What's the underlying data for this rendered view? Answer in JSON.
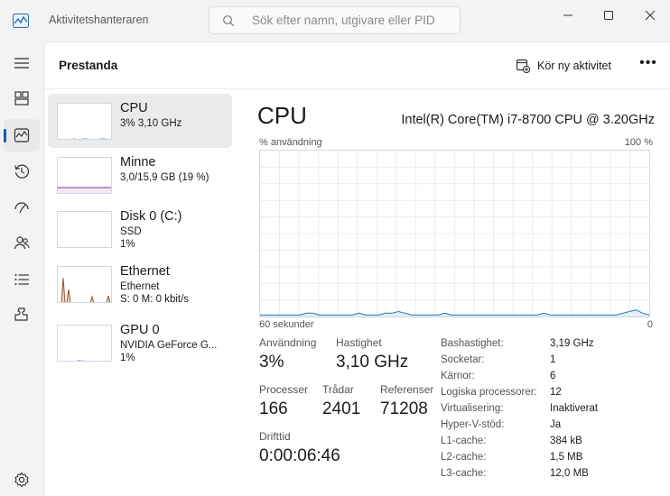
{
  "window": {
    "title": "Aktivitetshanteraren",
    "search_placeholder": "Sök efter namn, utgivare eller PID"
  },
  "nav": {
    "items": [
      {
        "icon": "hamburger-menu-icon"
      },
      {
        "icon": "processes-icon"
      },
      {
        "icon": "performance-icon",
        "active": true
      },
      {
        "icon": "app-history-icon"
      },
      {
        "icon": "startup-apps-icon"
      },
      {
        "icon": "users-icon"
      },
      {
        "icon": "details-icon"
      },
      {
        "icon": "services-icon"
      },
      {
        "icon": "settings-icon"
      }
    ]
  },
  "header": {
    "title": "Prestanda",
    "run_task_label": "Kör ny aktivitet",
    "more_label": "•••"
  },
  "devices": [
    {
      "name": "CPU",
      "line1": "3%  3,10 GHz",
      "line2": "",
      "active": true
    },
    {
      "name": "Minne",
      "line1": "3,0/15,9 GB (19 %)",
      "line2": ""
    },
    {
      "name": "Disk 0 (C:)",
      "line1": "SSD",
      "line2": "1%"
    },
    {
      "name": "Ethernet",
      "line1": "Ethernet",
      "line2": "S: 0  M: 0 kbit/s"
    },
    {
      "name": "GPU 0",
      "line1": "NVIDIA GeForce G...",
      "line2": "1%"
    }
  ],
  "detail": {
    "title": "CPU",
    "model": "Intel(R) Core(TM) i7-8700 CPU @ 3.20GHz",
    "util_label": "% användning",
    "max_label": "100 %",
    "seconds_label": "60 sekunder",
    "zero_label": "0",
    "stats": {
      "usage_label": "Användning",
      "usage_value": "3%",
      "speed_label": "Hastighet",
      "speed_value": "3,10 GHz",
      "processes_label": "Processer",
      "processes_value": "166",
      "threads_label": "Trådar",
      "threads_value": "2401",
      "handles_label": "Referenser",
      "handles_value": "71208",
      "uptime_label": "Drifttid",
      "uptime_value": "0:00:06:46"
    },
    "properties": [
      {
        "key": "Bashastighet:",
        "value": "3,19 GHz"
      },
      {
        "key": "Socketar:",
        "value": "1"
      },
      {
        "key": "Kärnor:",
        "value": "6"
      },
      {
        "key": "Logiska processorer:",
        "value": "12"
      },
      {
        "key": "Virtualisering:",
        "value": "Inaktiverat"
      },
      {
        "key": "Hyper-V-stöd:",
        "value": "Ja"
      },
      {
        "key": "L1-cache:",
        "value": "384 kB"
      },
      {
        "key": "L2-cache:",
        "value": "1,5 MB"
      },
      {
        "key": "L3-cache:",
        "value": "12,0 MB"
      }
    ],
    "cpu_history_percent": [
      1,
      1,
      1,
      1,
      1,
      1,
      1,
      2,
      2,
      1,
      1,
      1,
      1,
      1,
      1,
      2,
      1,
      1,
      1,
      2,
      2,
      3,
      2,
      1,
      1,
      1,
      1,
      1,
      2,
      1,
      1,
      1,
      1,
      1,
      1,
      1,
      1,
      1,
      1,
      1,
      1,
      1,
      1,
      2,
      1,
      1,
      1,
      1,
      1,
      1,
      1,
      1,
      1,
      1,
      1,
      2,
      3,
      4,
      2,
      1
    ]
  },
  "colors": {
    "accent": "#005fb8",
    "cpu_line": "#1f78b4",
    "memory_line": "#8e2fa8",
    "ethernet_line": "#a0522d",
    "grid": "#e6edf4"
  }
}
